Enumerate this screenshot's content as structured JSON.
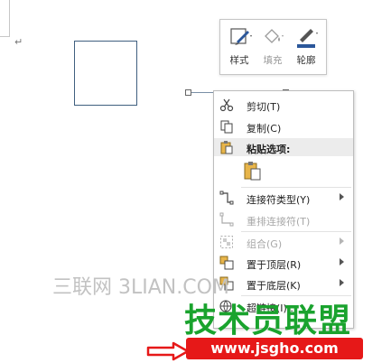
{
  "document": {
    "paragraph_mark": "↵"
  },
  "mini_toolbar": {
    "style_label": "样式",
    "fill_label": "填充",
    "outline_label": "轮廓"
  },
  "context_menu": {
    "cut": "剪切(T)",
    "copy": "复制(C)",
    "paste_options": "粘贴选项:",
    "connector_type": "连接符类型(Y)",
    "reroute_connector": "重排连接符(T)",
    "group": "组合(G)",
    "bring_to_front": "置于顶层(R)",
    "send_to_back": "置于底层(K)",
    "hyperlink": "超链接(I)..."
  },
  "watermarks": {
    "site_cn": "三联网 3LIAN.COM",
    "logo_cn": "技术员联盟",
    "logo_url": "www.jsgho.com"
  },
  "colors": {
    "accent_blue": "#2b579a",
    "shape_border": "#3f5f7f",
    "watermark_green": "#1aa32e",
    "watermark_red": "#e61818"
  }
}
